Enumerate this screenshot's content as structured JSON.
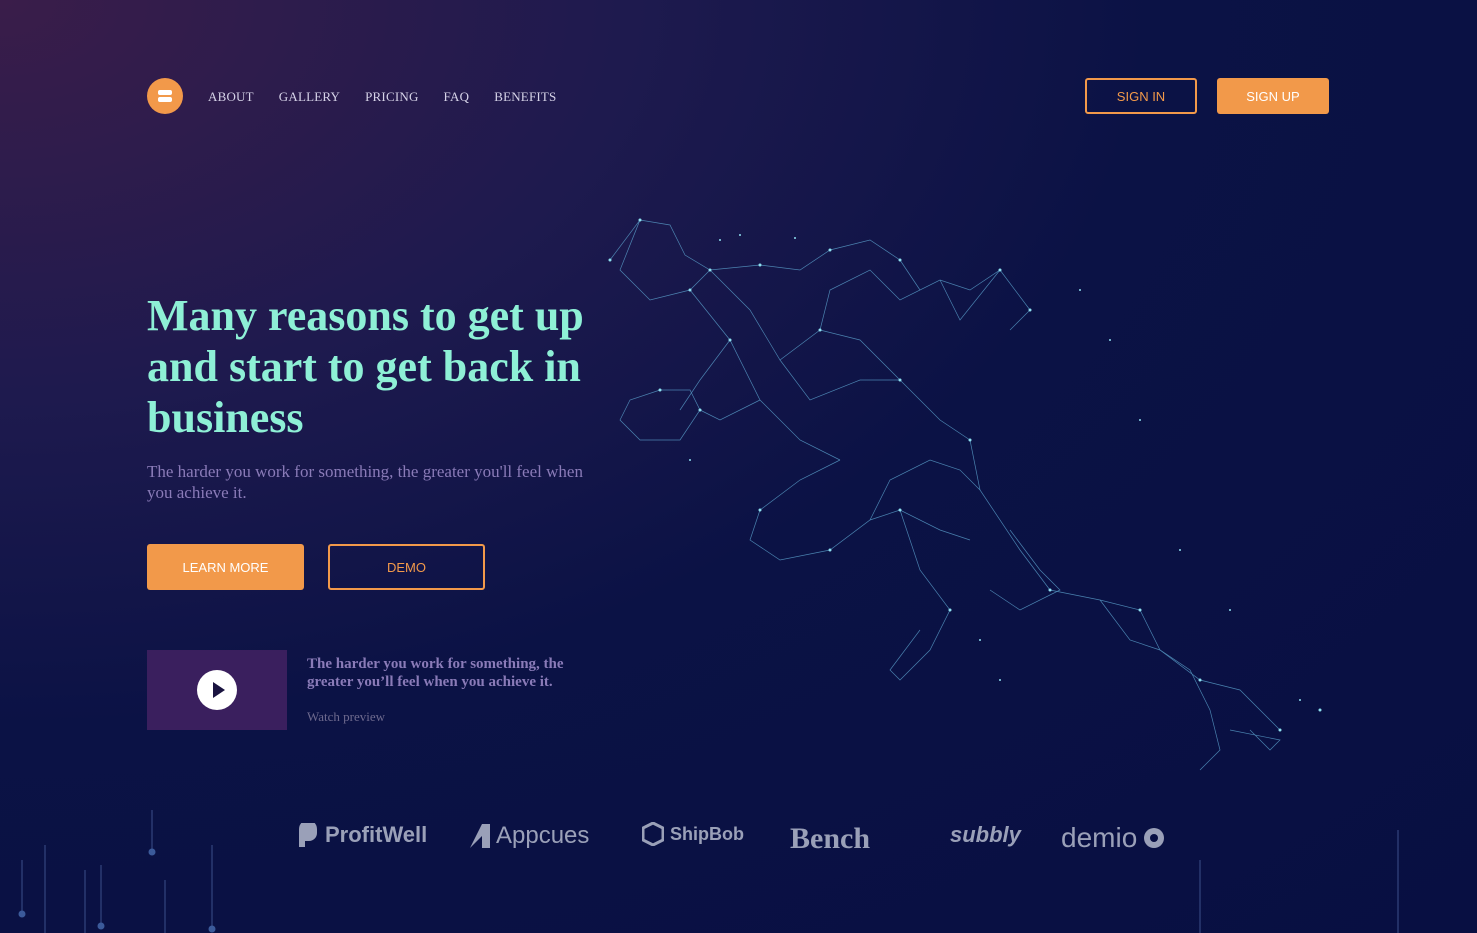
{
  "nav": {
    "items": [
      "ABOUT",
      "GALLERY",
      "PRICING",
      "FAQ",
      "BENEFITS"
    ]
  },
  "header": {
    "sign_in": "SIGN IN",
    "sign_up": "SIGN UP"
  },
  "hero": {
    "title": "Many reasons to get up and start to get back in business",
    "subtitle": "The harder you work for something, the greater you'll feel when you achieve it.",
    "learn_more": "LEARN MORE",
    "demo": "DEMO"
  },
  "video": {
    "text": "The harder you work for something, the greater you’ll feel when you achieve it.",
    "link": "Watch preview"
  },
  "brands": [
    "ProfitWell",
    "Appcues",
    "ShipBob",
    "Bench",
    "subbly",
    "demio"
  ],
  "colors": {
    "accent": "#f2994a",
    "heading": "#8ef0d6",
    "muted": "#8a7bb8",
    "background": "#080f42"
  },
  "icons": [
    "logo-icon",
    "play-icon"
  ]
}
